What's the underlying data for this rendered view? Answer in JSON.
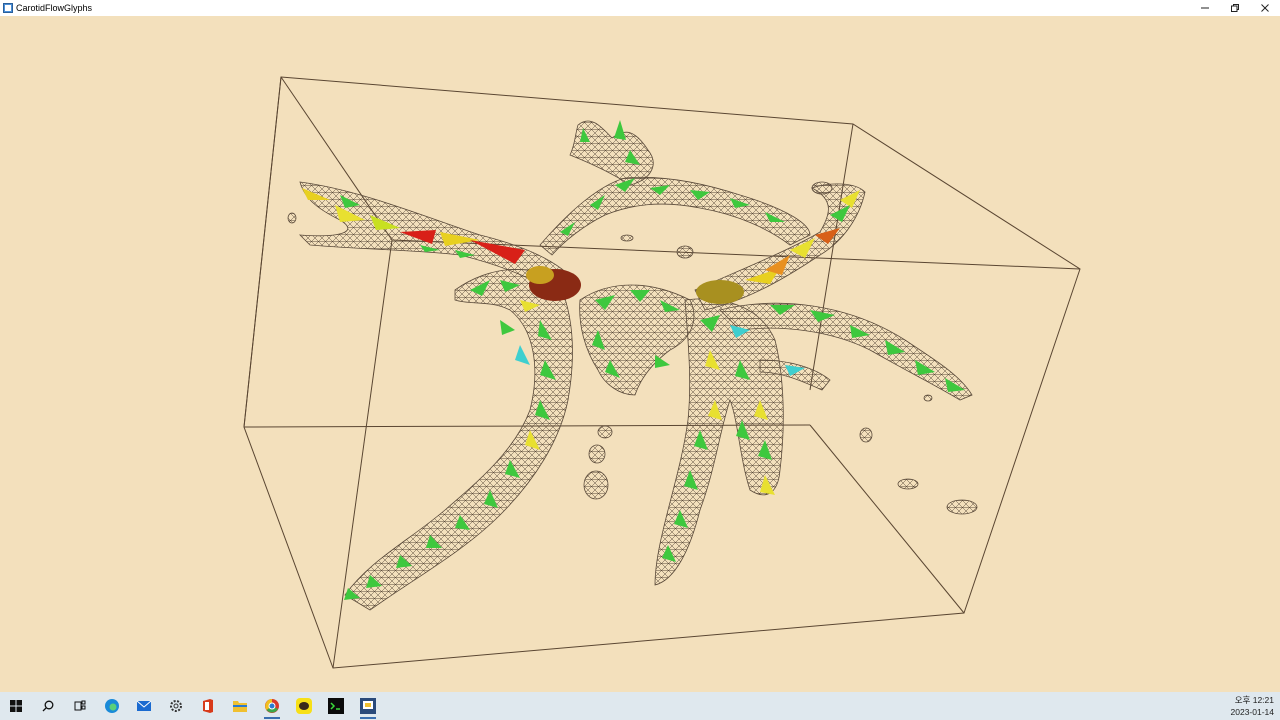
{
  "window": {
    "title": "CarotidFlowGlyphs"
  },
  "colors": {
    "background": "#f3e0bc",
    "mesh": "#5a4a3a",
    "glyph_low": "#3ec83e",
    "glyph_mid": "#e8e020",
    "glyph_high": "#d82018",
    "taskbar": "#dfe8ee"
  },
  "taskbar": {
    "icons": [
      "windows-start-icon",
      "search-icon",
      "task-view-icon",
      "edge-icon",
      "mail-icon",
      "settings-icon",
      "office-icon",
      "file-explorer-icon",
      "chrome-icon",
      "kakaotalk-icon",
      "terminal-icon",
      "app-icon"
    ],
    "clock_time": "오후 12:21",
    "clock_date": "2023-01-14"
  }
}
